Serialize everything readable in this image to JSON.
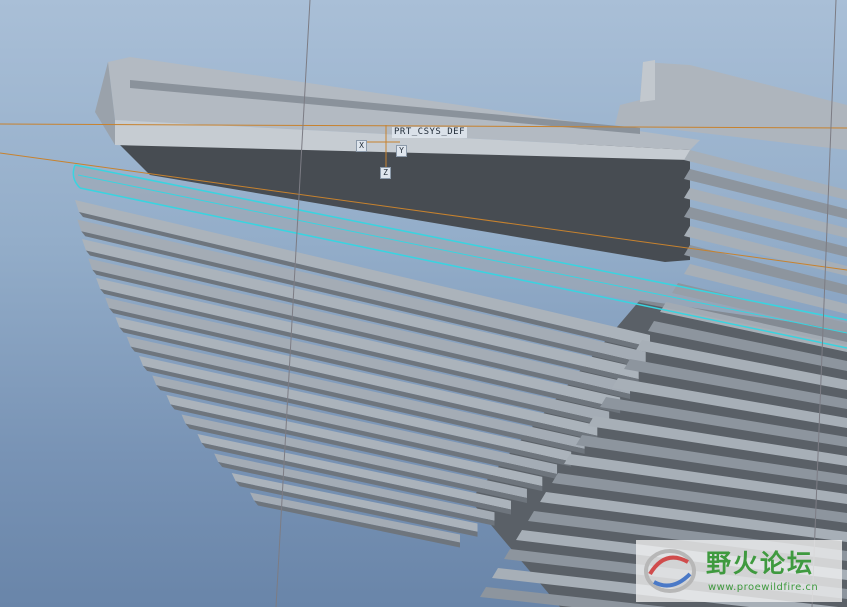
{
  "viewport": {
    "background_top": "#a9bfd7",
    "background_bottom": "#6985a9",
    "highlight_color": "#39d4e0",
    "datum_color": "#c7822e",
    "axis_line_color": "#7c7c84"
  },
  "csys": {
    "name": "PRT_CSYS_DEF",
    "axis_x": "X",
    "axis_y": "Y",
    "axis_z": "Z"
  },
  "watermark": {
    "chinese_text": "野火论坛",
    "url": "www.proewildfire.cn",
    "logo_icon": "wildfire-swirl-icon"
  }
}
